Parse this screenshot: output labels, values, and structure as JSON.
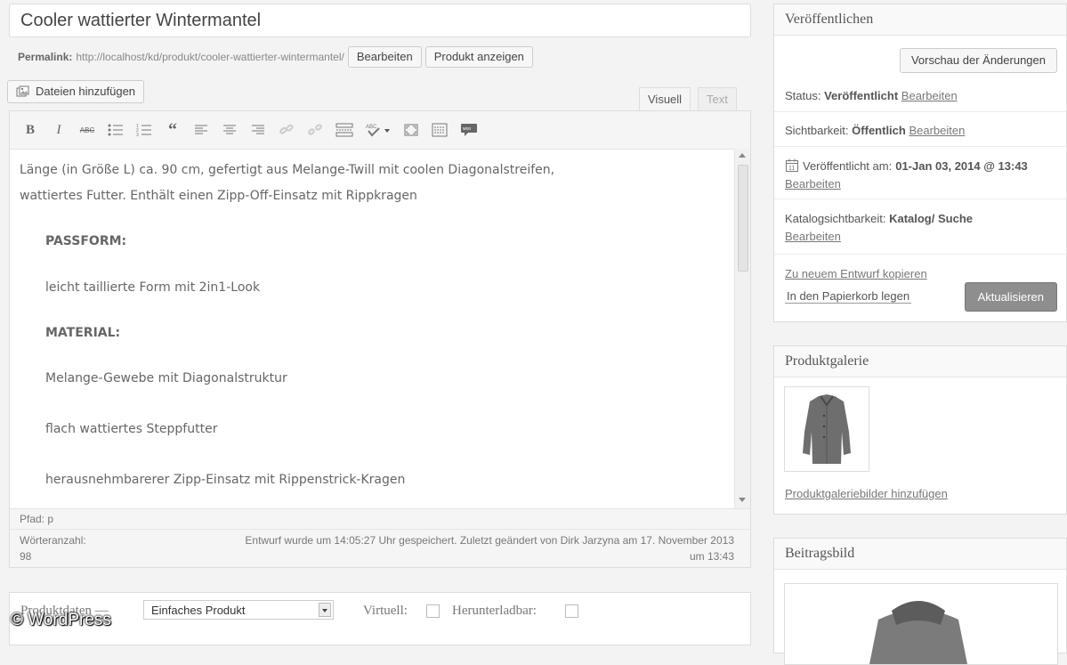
{
  "title": "Cooler wattierter Wintermantel",
  "permalink": {
    "label": "Permalink:",
    "url": "http://localhost/kd/produkt/cooler-wattierter-wintermantel/",
    "edit": "Bearbeiten",
    "view": "Produkt anzeigen"
  },
  "media": {
    "add_label": "Dateien hinzufügen"
  },
  "tabs": {
    "visual": "Visuell",
    "text": "Text"
  },
  "toolbar": {
    "bold": "B",
    "italic": "I",
    "strike": "ABC",
    "quote": "“"
  },
  "content": {
    "intro1": "Länge (in Größe L) ca. 90 cm, gefertigt aus Melange-Twill mit coolen Diagonalstreifen,",
    "intro2": "wattiertes Futter. Enthält einen Zipp-Off-Einsatz mit Rippkragen",
    "passform_h": "PASSFORM:",
    "passform": "leicht taillierte Form mit 2in1-Look",
    "material_h": "MATERIAL:",
    "m1": "Melange-Gewebe mit Diagonalstruktur",
    "m2": "flach wattiertes Steppfutter",
    "m3": "herausnehmbarerer Zipp-Einsatz mit Rippenstrick-Kragen"
  },
  "footer": {
    "path": "Pfad: p",
    "word_label": "Wörteranzahl:",
    "word_count": "98",
    "status_line1": "Entwurf wurde um 14:05:27 Uhr gespeichert. Zuletzt geändert von Dirk Jarzyna am 17. November 2013",
    "status_line2": "um 13:43"
  },
  "product_data": {
    "label": "Produktdaten —",
    "type": "Einfaches Produkt",
    "virtual": "Virtuell:",
    "download": "Herunterladbar:"
  },
  "watermark": "© WordPress",
  "publish": {
    "title": "Veröffentlichen",
    "preview": "Vorschau der Änderungen",
    "status_label": "Status:",
    "status_value": "Veröffentlicht",
    "visibility_label": "Sichtbarkeit:",
    "visibility_value": "Öffentlich",
    "published_label": "Veröffentlicht am:",
    "published_value": "01-Jan 03, 2014 @ 13:43",
    "catalog_label": "Katalogsichtbarkeit:",
    "catalog_value": "Katalog/ Suche",
    "edit": "Bearbeiten",
    "copy": "Zu neuem Entwurf kopieren",
    "trash": "In den Papierkorb legen",
    "update": "Aktualisieren"
  },
  "gallery": {
    "title": "Produktgalerie",
    "add": "Produktgaleriebilder hinzufügen"
  },
  "featured": {
    "title": "Beitragsbild"
  }
}
